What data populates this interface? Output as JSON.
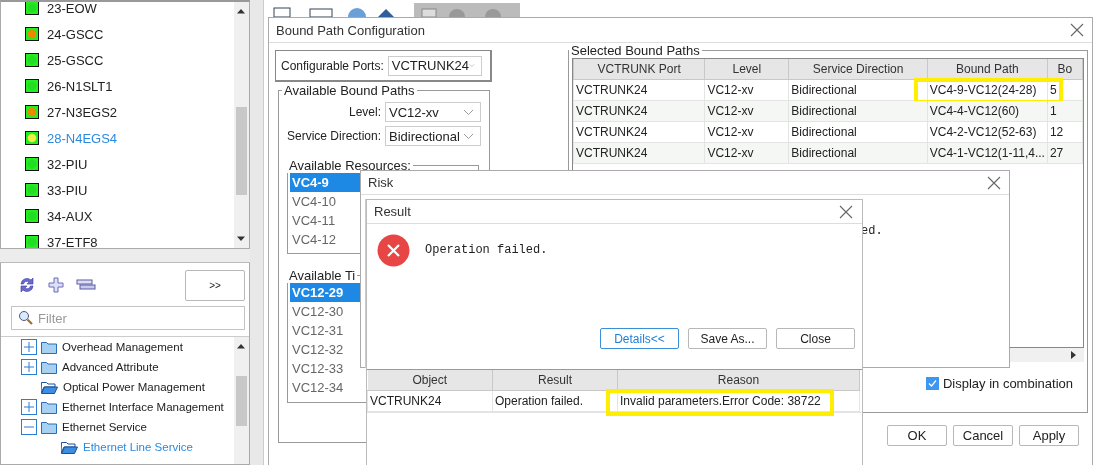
{
  "card_list": {
    "items": [
      {
        "label": "23-EOW",
        "color": "#22dd22",
        "selected": false
      },
      {
        "label": "24-GSCC",
        "color": "#ee8800",
        "selected": false
      },
      {
        "label": "25-GSCC",
        "color": "#22dd22",
        "selected": false
      },
      {
        "label": "26-N1SLT1",
        "color": "#22dd22",
        "selected": false
      },
      {
        "label": "27-N3EGS2",
        "color": "#ee8800",
        "selected": false
      },
      {
        "label": "28-N4EGS4",
        "color": "#eeee44",
        "selected": true
      },
      {
        "label": "32-PIU",
        "color": "#22dd22",
        "selected": false
      },
      {
        "label": "33-PIU",
        "color": "#22dd22",
        "selected": false
      },
      {
        "label": "34-AUX",
        "color": "#22dd22",
        "selected": false
      },
      {
        "label": "37-ETF8",
        "color": "#22dd22",
        "selected": false
      }
    ]
  },
  "function_tree": {
    "expand_button": ">>",
    "filter": {
      "placeholder": "Filter"
    },
    "items": [
      {
        "label": "Overhead Management",
        "kind": "folder",
        "expanded": false,
        "selected": false
      },
      {
        "label": "Advanced Attribute",
        "kind": "folder",
        "expanded": false,
        "selected": false
      },
      {
        "label": "Optical Power Management",
        "kind": "leaf",
        "selected": false
      },
      {
        "label": "Ethernet Interface Management",
        "kind": "folder",
        "expanded": false,
        "selected": false
      },
      {
        "label": "Ethernet Service",
        "kind": "folder",
        "expanded": true,
        "selected": false,
        "children": [
          {
            "label": "Ethernet Line Service",
            "kind": "leaf",
            "selected": true
          }
        ]
      }
    ]
  },
  "bound_path_dialog": {
    "title": "Bound Path Configuration",
    "configurable_ports": {
      "label": "Configurable Ports:",
      "value": "VCTRUNK24"
    },
    "available_bound_paths": {
      "title": "Available Bound Paths",
      "level": {
        "label": "Level:",
        "value": "VC12-xv"
      },
      "service_direction": {
        "label": "Service Direction:",
        "value": "Bidirectional"
      },
      "available_resources": {
        "title": "Available Resources:",
        "items": [
          {
            "label": "VC4-9",
            "selected": true
          },
          {
            "label": "VC4-10",
            "selected": false
          },
          {
            "label": "VC4-11",
            "selected": false
          },
          {
            "label": "VC4-12",
            "selected": false
          }
        ]
      },
      "available_timeslots": {
        "title": "Available Ti",
        "items": [
          {
            "label": "VC12-29",
            "selected": true
          },
          {
            "label": "VC12-30",
            "selected": false
          },
          {
            "label": "VC12-31",
            "selected": false
          },
          {
            "label": "VC12-32",
            "selected": false
          },
          {
            "label": "VC12-33",
            "selected": false
          },
          {
            "label": "VC12-34",
            "selected": false
          }
        ]
      }
    },
    "selected_bound_paths": {
      "title": "Selected Bound Paths",
      "columns": [
        "VCTRUNK Port",
        "Level",
        "Service Direction",
        "Bound Path",
        "Bo"
      ],
      "rows": [
        {
          "cells": [
            "VCTRUNK24",
            "VC12-xv",
            "Bidirectional",
            "VC4-9-VC12(24-28)",
            "5"
          ],
          "highlighted": true
        },
        {
          "cells": [
            "VCTRUNK24",
            "VC12-xv",
            "Bidirectional",
            "VC4-4-VC12(60)",
            "1"
          ],
          "highlighted": false
        },
        {
          "cells": [
            "VCTRUNK24",
            "VC12-xv",
            "Bidirectional",
            "VC4-2-VC12(52-63)",
            "12"
          ],
          "highlighted": false
        },
        {
          "cells": [
            "VCTRUNK24",
            "VC12-xv",
            "Bidirectional",
            "VC4-1-VC12(1-11,4...",
            "27"
          ],
          "highlighted": false
        }
      ],
      "display_in_combination": {
        "label": "Display in combination",
        "checked": true
      }
    },
    "buttons": [
      "OK",
      "Cancel",
      "Apply"
    ]
  },
  "risk_dialog": {
    "title": "Risk",
    "message": "ed."
  },
  "result_dialog": {
    "title": "Result",
    "message": "Operation failed.",
    "buttons": [
      {
        "label": "Details<<",
        "selected": true
      },
      {
        "label": "Save As...",
        "selected": false
      },
      {
        "label": "Close",
        "selected": false
      }
    ],
    "columns": [
      "Object",
      "Result",
      "Reason"
    ],
    "rows": [
      {
        "cells": [
          "VCTRUNK24",
          "Operation failed.",
          "Invalid parameters.Error Code: 38722"
        ],
        "highlighted": true
      }
    ]
  }
}
